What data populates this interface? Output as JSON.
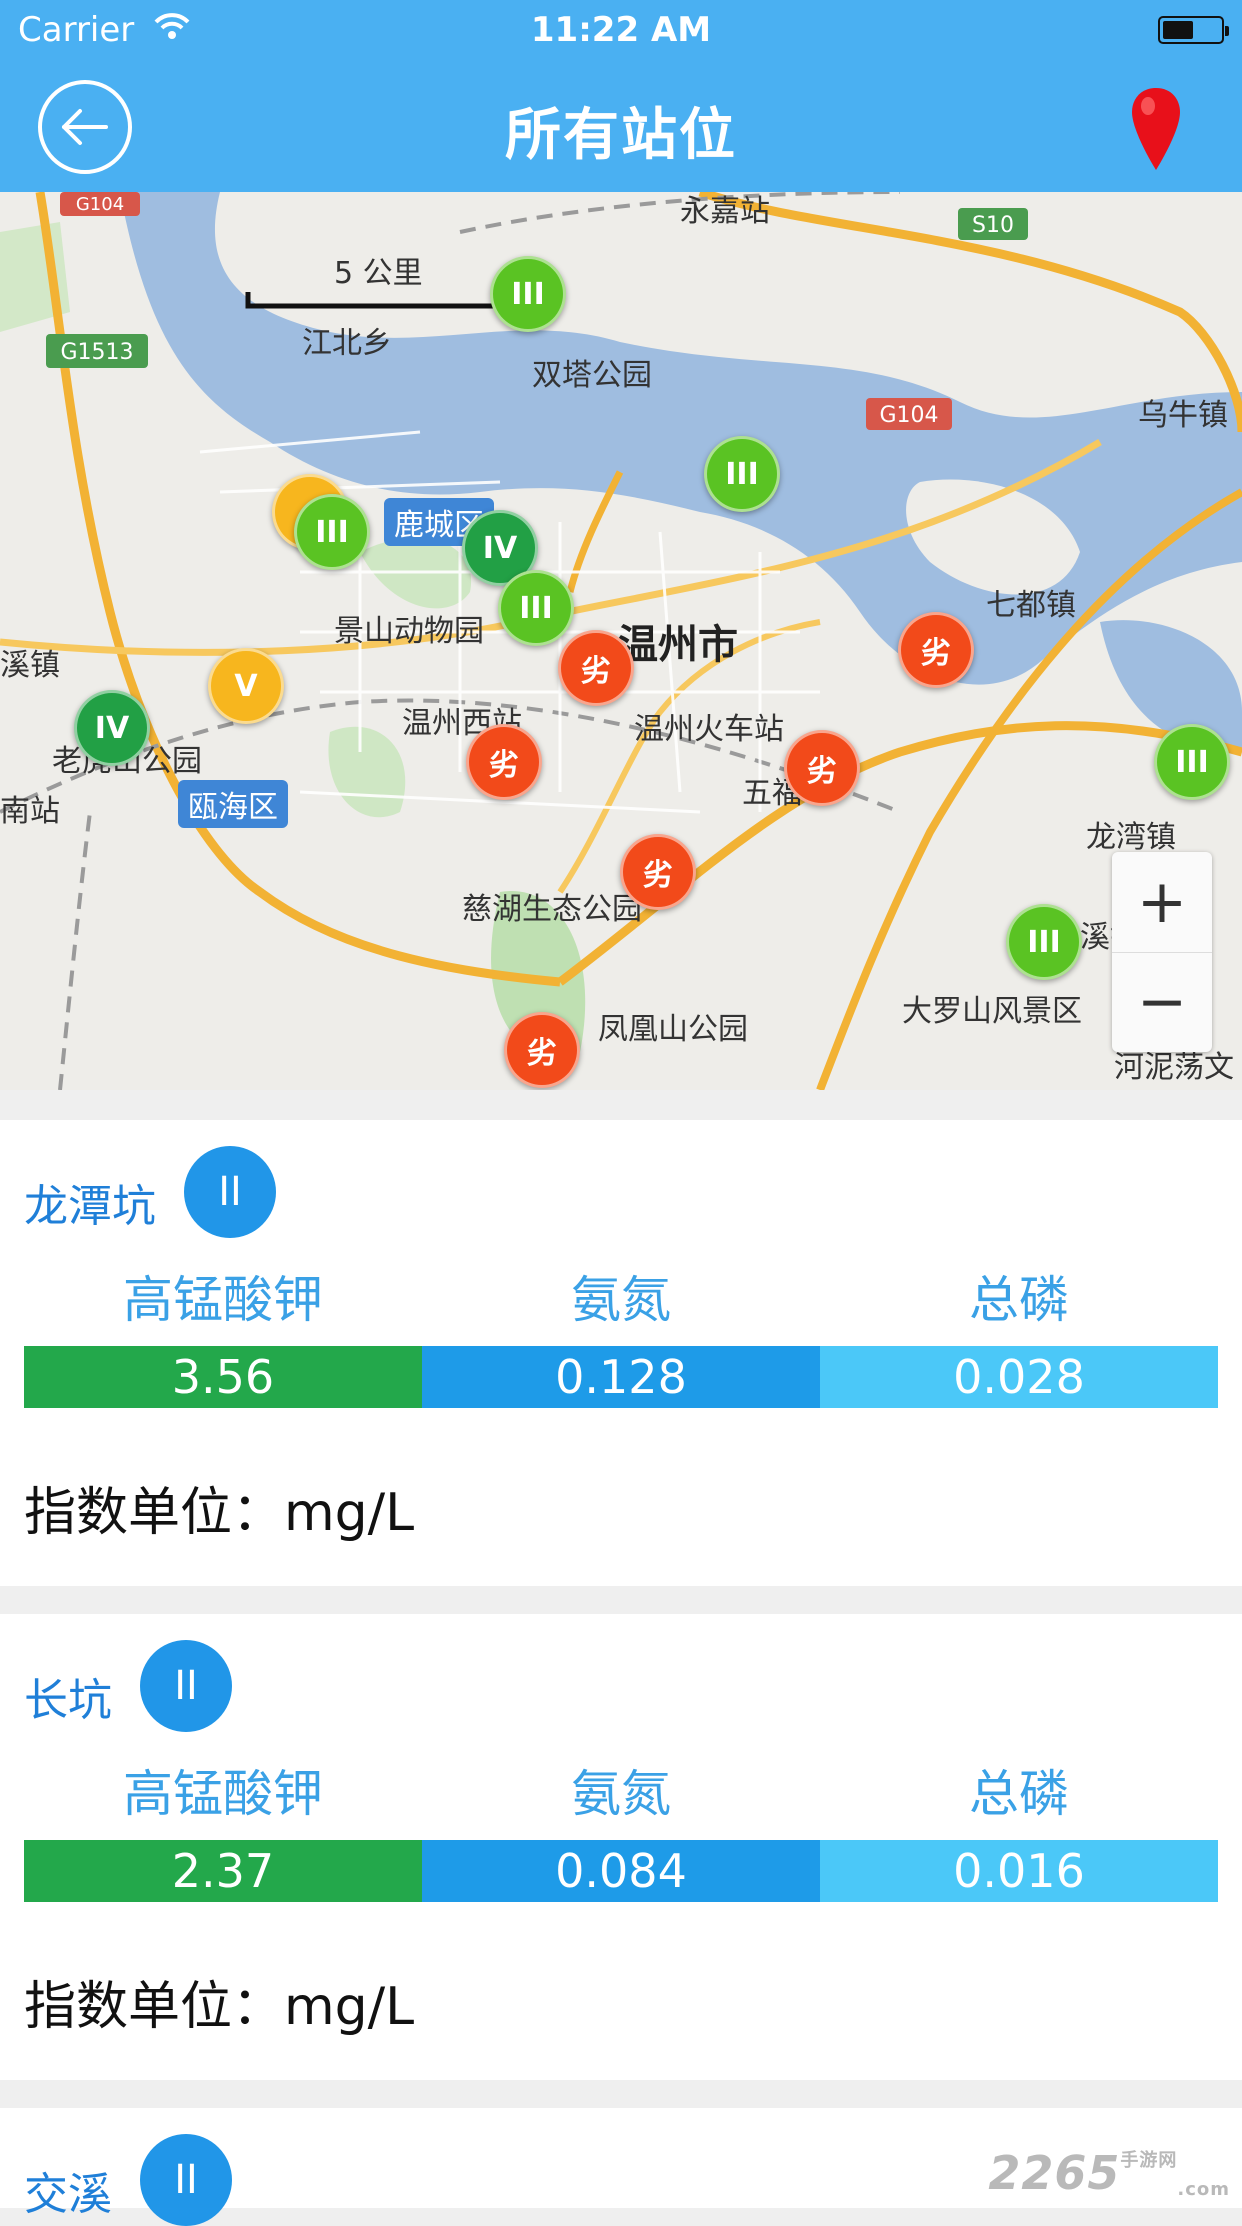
{
  "status_bar": {
    "carrier": "Carrier",
    "time": "11:22 AM"
  },
  "header": {
    "title": "所有站位"
  },
  "map": {
    "scale_label": "5 公里",
    "place_labels": [
      {
        "id": "jiangbei",
        "text": "江北乡"
      },
      {
        "id": "shuangta",
        "text": "双塔公园"
      },
      {
        "id": "wuniu",
        "text": "乌牛镇"
      },
      {
        "id": "lucheng",
        "text": "鹿城区"
      },
      {
        "id": "jingshan",
        "text": "景山动物园"
      },
      {
        "id": "wenzhou",
        "text": "温州市"
      },
      {
        "id": "qidu",
        "text": "七都镇"
      },
      {
        "id": "wzxz",
        "text": "温州西站"
      },
      {
        "id": "wzhcz",
        "text": "温州火车站"
      },
      {
        "id": "laodong",
        "text": "老虎山公园"
      },
      {
        "id": "ouhai",
        "text": "瓯海区"
      },
      {
        "id": "wuma",
        "text": "五福"
      },
      {
        "id": "longwan",
        "text": "龙湾镇"
      },
      {
        "id": "cihu",
        "text": "慈湖生态公园"
      },
      {
        "id": "fenghuang",
        "text": "凤凰山公园"
      },
      {
        "id": "daluoshan",
        "text": "大罗山风景区"
      },
      {
        "id": "xixi",
        "text": "溪镇"
      },
      {
        "id": "nanzhan",
        "text": "南站"
      },
      {
        "id": "xizhen",
        "text": "溪镇"
      },
      {
        "id": "yongjia",
        "text": "永嘉站"
      },
      {
        "id": "hebang",
        "text": "河泥荡文"
      }
    ],
    "road_labels": [
      "G104",
      "S10",
      "G1513",
      "G104"
    ],
    "markers": [
      {
        "label": "III",
        "color": "green"
      },
      {
        "label": "III",
        "color": "green"
      },
      {
        "label": "III",
        "color": "green"
      },
      {
        "label": "IV",
        "color": "dgreen"
      },
      {
        "label": "III",
        "color": "green"
      },
      {
        "label": "V",
        "color": "orange"
      },
      {
        "label": "IV",
        "color": "dgreen"
      },
      {
        "label": "劣",
        "color": "red"
      },
      {
        "label": "劣",
        "color": "red"
      },
      {
        "label": "劣",
        "color": "red"
      },
      {
        "label": "劣",
        "color": "red"
      },
      {
        "label": "劣",
        "color": "red"
      },
      {
        "label": "劣",
        "color": "red"
      },
      {
        "label": "III",
        "color": "green"
      },
      {
        "label": "III",
        "color": "green"
      },
      {
        "label": "",
        "color": "orange"
      }
    ],
    "zoom_in": "+",
    "zoom_out": "−"
  },
  "stations": [
    {
      "name": "龙潭坑",
      "grade": "II",
      "params": [
        "高锰酸钾",
        "氨氮",
        "总磷"
      ],
      "values": [
        "3.56",
        "0.128",
        "0.028"
      ],
      "unit_text": "指数单位：mg/L"
    },
    {
      "name": "长坑",
      "grade": "II",
      "params": [
        "高锰酸钾",
        "氨氮",
        "总磷"
      ],
      "values": [
        "2.37",
        "0.084",
        "0.016"
      ],
      "unit_text": "指数单位：mg/L"
    },
    {
      "name": "交溪",
      "grade": "II"
    }
  ],
  "watermark": {
    "main": "2265",
    "sub": "手游网",
    "domain": ".com"
  },
  "colors": {
    "header": "#4ab0f2",
    "grade_badge": "#2196e8",
    "value_permanganate": "#23a84b",
    "value_ammonia": "#1e9be8",
    "value_phosphorus": "#4bc8f8",
    "marker_green": "#5ac323",
    "marker_dark_green": "#22a045",
    "marker_orange": "#f7b61e",
    "marker_red": "#f24a1a"
  },
  "icons": [
    "wifi-icon",
    "battery-icon",
    "back-arrow-icon",
    "location-pin-icon"
  ]
}
